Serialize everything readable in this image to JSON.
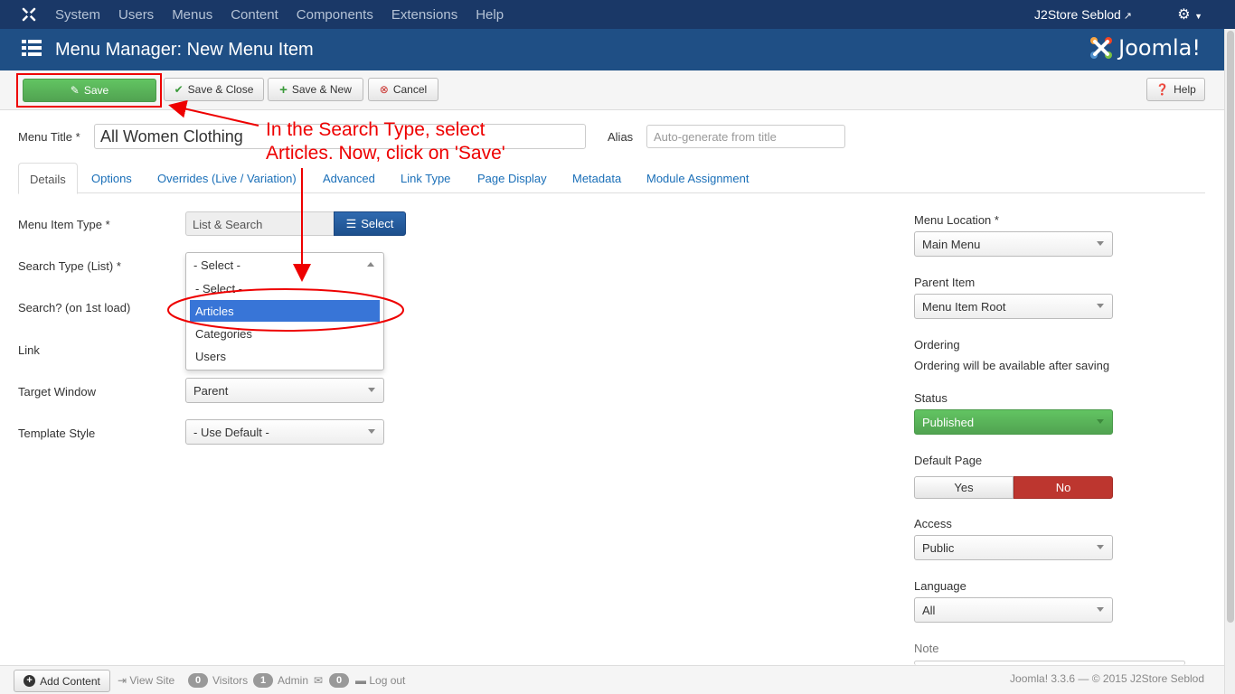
{
  "navbar": {
    "menu": [
      "System",
      "Users",
      "Menus",
      "Content",
      "Components",
      "Extensions",
      "Help"
    ],
    "site_name": "J2Store Seblod",
    "site_ext_icon": "external-link-icon",
    "gear_icon": "gear-icon"
  },
  "header": {
    "title": "Menu Manager: New Menu Item",
    "brand": "Joomla!",
    "icon": "list-icon"
  },
  "toolbar": {
    "save": "Save",
    "save_close": "Save & Close",
    "save_new": "Save & New",
    "cancel": "Cancel",
    "help": "Help"
  },
  "form": {
    "menu_title_label": "Menu Title *",
    "menu_title_value": "All Women Clothing",
    "alias_label": "Alias",
    "alias_placeholder": "Auto-generate from title"
  },
  "tabs": [
    "Details",
    "Options",
    "Overrides (Live / Variation)",
    "Advanced",
    "Link Type",
    "Page Display",
    "Metadata",
    "Module Assignment"
  ],
  "details": {
    "menu_item_type_label": "Menu Item Type *",
    "menu_item_type_value": "List & Search",
    "select_button": "Select",
    "search_type_label": "Search Type (List) *",
    "search_type_value": "- Select -",
    "search_type_options": [
      "- Select -",
      "Articles",
      "Categories",
      "Users"
    ],
    "search_type_highlighted": "Articles",
    "search_first_load_label": "Search? (on 1st load)",
    "link_label": "Link",
    "target_window_label": "Target Window",
    "target_window_value": "Parent",
    "template_style_label": "Template Style",
    "template_style_value": "- Use Default -"
  },
  "sidebar": {
    "menu_location_label": "Menu Location *",
    "menu_location_value": "Main Menu",
    "parent_item_label": "Parent Item",
    "parent_item_value": "Menu Item Root",
    "ordering_label": "Ordering",
    "ordering_text": "Ordering will be available after saving",
    "status_label": "Status",
    "status_value": "Published",
    "default_page_label": "Default Page",
    "default_yes": "Yes",
    "default_no": "No",
    "access_label": "Access",
    "access_value": "Public",
    "language_label": "Language",
    "language_value": "All",
    "note_label": "Note"
  },
  "footer": {
    "add_content": "Add Content",
    "view_site": "View Site",
    "visitors_count": "0",
    "visitors_label": "Visitors",
    "admin_count": "1",
    "admin_label": "Admin",
    "messages_count": "0",
    "logout": "Log out",
    "copyright": "Joomla! 3.3.6  —  © 2015 J2Store Seblod"
  },
  "annotation": {
    "line1": "In the Search Type, select",
    "line2": "Articles. Now, click on 'Save'",
    "color": "#e00000"
  }
}
